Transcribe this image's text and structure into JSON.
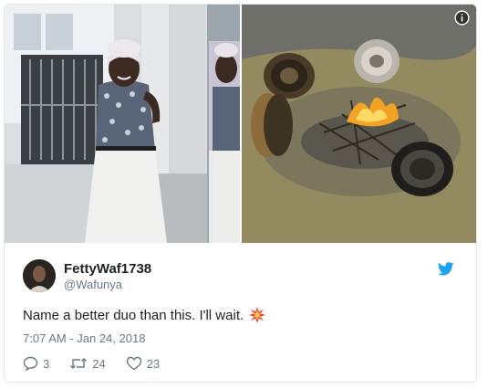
{
  "tweet": {
    "display_name": "FettyWaf1738",
    "handle": "@Wafunya",
    "text": "Name a better duo than this. I'll wait.",
    "emoji_icon": "collision-icon",
    "timestamp": "7:07 AM - Jan 24, 2018",
    "reply_count": "3",
    "retweet_count": "24",
    "like_count": "23",
    "brand_icon": "twitter-bird-icon",
    "media_info_icon": "info-icon"
  },
  "colors": {
    "twitter_blue": "#1da1f2",
    "text_primary": "#1c2022",
    "text_secondary": "#697882",
    "border": "#e1e8ed"
  }
}
